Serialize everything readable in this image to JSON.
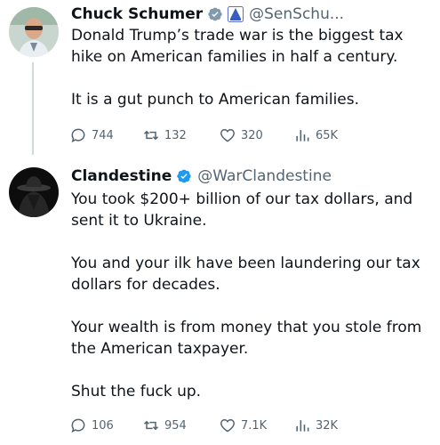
{
  "tweets": [
    {
      "author_name": "Chuck Schumer",
      "handle": "@SenSchu...",
      "verified_color": "#829aab",
      "affiliation_badge": "us-government-badge",
      "paragraphs": [
        "Donald Trump’s trade war is the biggest tax hike on American families in half a century.",
        "It is a gut punch to American families."
      ],
      "stats": {
        "replies": "744",
        "reposts": "132",
        "likes": "320",
        "views": "65K"
      }
    },
    {
      "author_name": "Clandestine",
      "handle": "@WarClandestine",
      "verified_color": "#1d9bf0",
      "paragraphs": [
        "You took $200+ billion of our tax dollars, and sent it to Ukraine.",
        "You and your ilk have been laundering our tax dollars for decades.",
        "Your wealth is from money that you stole from the American taxpayer.",
        "Shut the fuck up."
      ],
      "stats": {
        "replies": "106",
        "reposts": "954",
        "likes": "7.1K",
        "views": "32K"
      }
    }
  ],
  "colors": {
    "text": "#0f1419",
    "secondary": "#536471",
    "thread_line": "#cfd9de"
  }
}
